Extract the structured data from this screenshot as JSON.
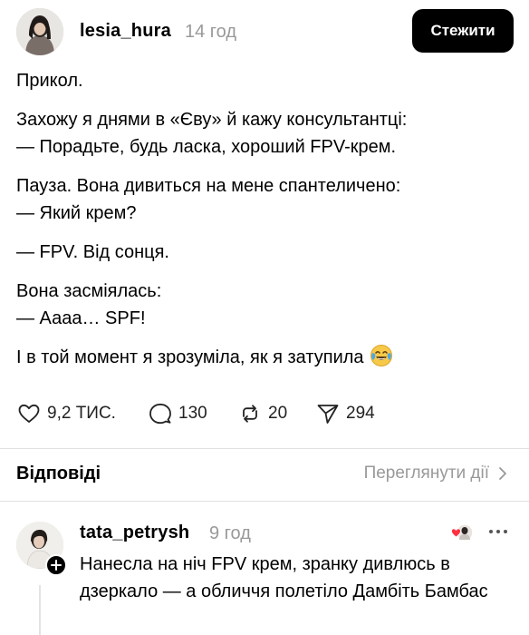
{
  "post": {
    "username": "lesia_hura",
    "time": "14 год",
    "follow_label": "Стежити",
    "paragraphs": [
      "Прикол.",
      "Захожу я днями в «Єву» й кажу консультантці:",
      "— Порадьте, будь ласка, хороший FPV-крем.",
      "Пауза. Вона дивиться на мене спантеличено:",
      "— Який крем?",
      "— FPV. Від сонця.",
      "Вона засміялась:",
      "— Аааа… SPF!",
      "І в той момент я зрозуміла, як я затупила"
    ],
    "trailing_emoji": "face-with-tears-of-joy",
    "actions": {
      "likes": "9,2 ТИС.",
      "replies": "130",
      "reposts": "20",
      "shares": "294"
    }
  },
  "replies_section": {
    "title": "Відповіді",
    "view_activity": "Переглянути дії"
  },
  "reply": {
    "username": "tata_petrysh",
    "time": "9 год",
    "text": "Нанесла на ніч FPV крем, зранку дивлюсь в дзеркало — а обличчя полетіло Дамбіть Бамбас",
    "liked_by_author": true
  },
  "icons": {
    "like": "heart-outline-icon",
    "reply": "speech-bubble-icon",
    "repost": "repost-arrows-icon",
    "share": "paper-plane-icon",
    "chevron": "chevron-right-icon",
    "more": "more-dots-icon",
    "follow_badge": "plus-icon"
  },
  "colors": {
    "primary_text": "#000000",
    "secondary_text": "#999999",
    "button_bg": "#000000",
    "button_text": "#ffffff",
    "divider": "#e0e0e0",
    "like_heart": "#ff3040"
  }
}
